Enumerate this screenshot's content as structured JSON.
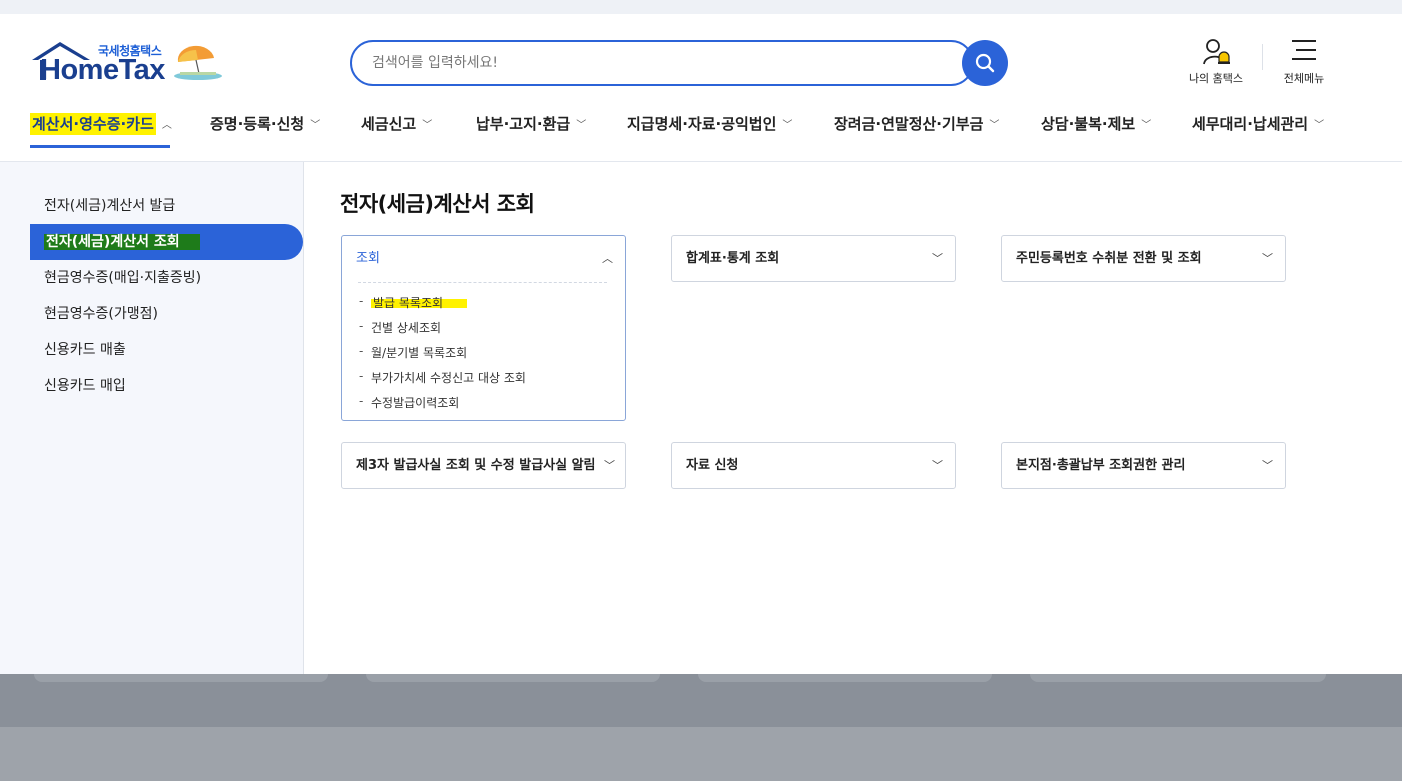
{
  "logo": {
    "sub": "국세청홈택스",
    "main": "HomeTax"
  },
  "search": {
    "placeholder": "검색어를 입력하세요!"
  },
  "utility": {
    "my_hometax": "나의 홈택스",
    "all_menu": "전체메뉴"
  },
  "gnb": [
    {
      "label": "계산서·영수증·카드",
      "active": true
    },
    {
      "label": "증명·등록·신청"
    },
    {
      "label": "세금신고"
    },
    {
      "label": "납부·고지·환급"
    },
    {
      "label": "지급명세·자료·공익법인"
    },
    {
      "label": "장려금·연말정산·기부금"
    },
    {
      "label": "상담·불복·제보"
    },
    {
      "label": "세무대리·납세관리"
    }
  ],
  "sidebar": [
    {
      "label": "전자(세금)계산서 발급"
    },
    {
      "label": "전자(세금)계산서 조회",
      "active": true
    },
    {
      "label": "현금영수증(매입·지출증빙)"
    },
    {
      "label": "현금영수증(가맹점)"
    },
    {
      "label": "신용카드 매출"
    },
    {
      "label": "신용카드 매입"
    }
  ],
  "page_title": "전자(세금)계산서 조회",
  "cards": [
    {
      "title": "조회",
      "open": true,
      "items": [
        "발급 목록조회",
        "건별 상세조회",
        "월/분기별 목록조회",
        "부가가치세 수정신고 대상 조회",
        "수정발급이력조회"
      ]
    },
    {
      "title": "합계표·통계 조회"
    },
    {
      "title": "주민등록번호 수취분 전환 및 조회"
    },
    {
      "title": "제3자 발급사실 조회 및 수정 발급사실 알림"
    },
    {
      "title": "자료 신청"
    },
    {
      "title": "본지점·총괄납부 조회권한 관리"
    }
  ],
  "icons": {
    "search": "search-icon",
    "my": "user-bell-icon",
    "menu": "hamburger-icon",
    "chev_down": "chevron-down-icon",
    "chev_up": "chevron-up-icon"
  },
  "colors": {
    "accent": "#2b63d8",
    "brand": "#1a3f8f",
    "highlight": "#fff200",
    "highlight_green": "#1e7b1a"
  }
}
